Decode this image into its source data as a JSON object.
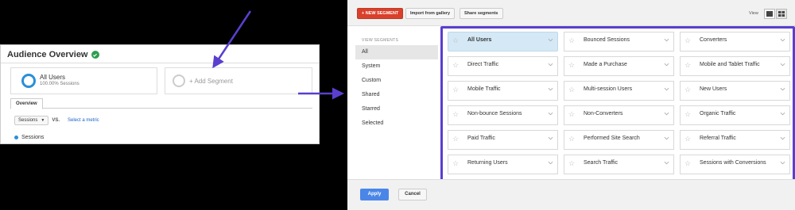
{
  "overview": {
    "title": "Audience Overview",
    "segment_name": "All Users",
    "segment_sub": "100.00% Sessions",
    "add_segment": "+ Add Segment",
    "tab": "Overview",
    "metric_select": "Sessions",
    "vs": "VS.",
    "select_metric": "Select a metric",
    "legend_item": "Sessions"
  },
  "picker": {
    "new_segment": "+ NEW SEGMENT",
    "import": "Import from gallery",
    "share": "Share segments",
    "view_label": "View",
    "sidebar_head": "VIEW SEGMENTS",
    "sidebar": [
      "All",
      "System",
      "Custom",
      "Shared",
      "Starred",
      "Selected"
    ],
    "segments": [
      "All Users",
      "Bounced Sessions",
      "Converters",
      "Direct Traffic",
      "Made a Purchase",
      "Mobile and Tablet Traffic",
      "Mobile Traffic",
      "Multi-session Users",
      "New Users",
      "Non-bounce Sessions",
      "Non-Converters",
      "Organic Traffic",
      "Paid Traffic",
      "Performed Site Search",
      "Referral Traffic",
      "Returning Users",
      "Search Traffic",
      "Sessions with Conversions"
    ],
    "apply": "Apply",
    "cancel": "Cancel"
  },
  "colors": {
    "highlight_border": "#5a3fcf",
    "new_segment_btn": "#d9402b",
    "apply_btn": "#4a86e8",
    "selected_cell": "#d4e8f5"
  }
}
